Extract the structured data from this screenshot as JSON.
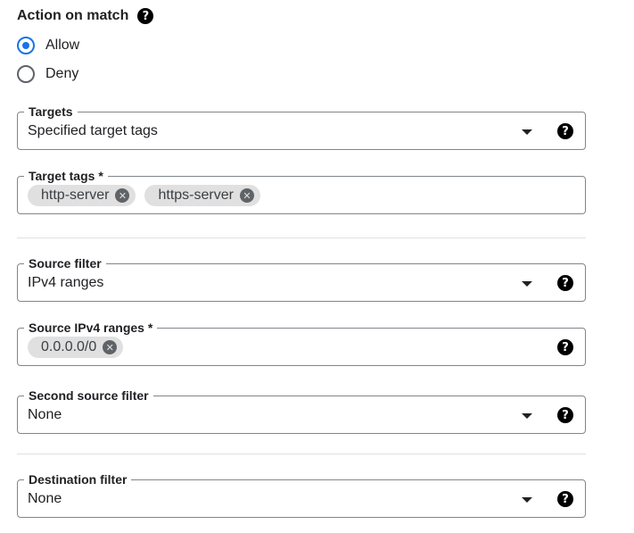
{
  "action": {
    "title": "Action on match",
    "help_icon": "help-icon",
    "options": [
      {
        "label": "Allow",
        "selected": true
      },
      {
        "label": "Deny",
        "selected": false
      }
    ]
  },
  "targets": {
    "label": "Targets",
    "value": "Specified target tags"
  },
  "target_tags": {
    "label": "Target tags *",
    "chips": [
      "http-server",
      "https-server"
    ]
  },
  "source_filter": {
    "label": "Source filter",
    "value": "IPv4 ranges"
  },
  "source_ranges": {
    "label": "Source IPv4 ranges *",
    "chips": [
      "0.0.0.0/0"
    ]
  },
  "second_source_filter": {
    "label": "Second source filter",
    "value": "None"
  },
  "destination_filter": {
    "label": "Destination filter",
    "value": "None"
  },
  "colors": {
    "accent": "#1a73e8",
    "border": "#80868b",
    "chip_bg": "#e0e0e0"
  }
}
